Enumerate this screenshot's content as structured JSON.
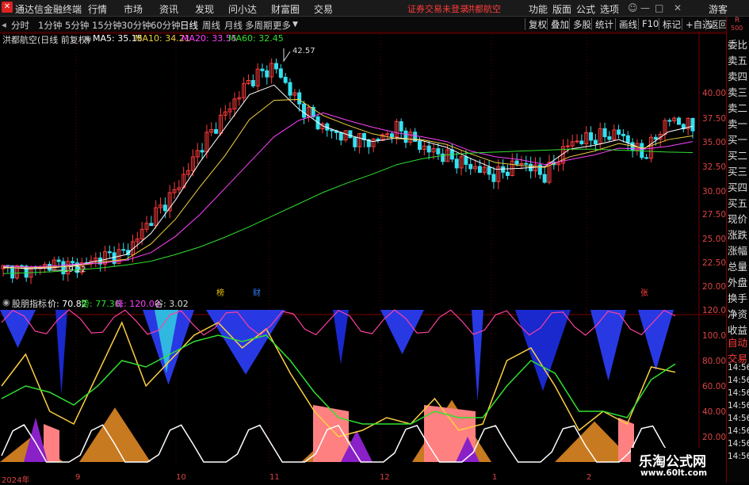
{
  "menubar": {
    "app_title": "通达信金融终端",
    "menus": [
      "行情",
      "市场",
      "资讯",
      "发现",
      "问小达",
      "财富圈",
      "交易"
    ],
    "status_text": "证券交易未登录",
    "stock_name": "洪都航空",
    "right_menus": [
      "功能",
      "版面",
      "公式",
      "选项"
    ],
    "guest": "游客"
  },
  "periodbar": {
    "periods": [
      "分时",
      "1分钟",
      "5分钟",
      "15分钟",
      "30分钟",
      "60分钟",
      "日线",
      "周线",
      "月线",
      "多周期",
      "更多"
    ],
    "active": "日线",
    "tools": [
      "复权",
      "叠加",
      "多股",
      "统计",
      "画线",
      "F10",
      "标记",
      "+自选",
      "返回"
    ]
  },
  "main_legend": {
    "title": "洪都航空(日线 前复权)",
    "ma5": "MA5: 35.15",
    "ma10": "MA10: 34.21",
    "ma20": "MA20: 33.55",
    "ma60": "MA60: 32.45"
  },
  "price_annotations": {
    "high": "42.57",
    "low": "19.22"
  },
  "price_axis": [
    "40.00",
    "37.50",
    "35.00",
    "32.50",
    "30.00",
    "27.50",
    "25.00",
    "22.50",
    "20.00"
  ],
  "event_marks": [
    "榜",
    "财",
    "张"
  ],
  "sub_legend": {
    "title": "股朋指标",
    "price": "价: 70.82",
    "trend": "势: 77.36",
    "top": "峰: 120.00",
    "bottom": "谷: 3.02"
  },
  "sub_axis": [
    "120.0",
    "100.0",
    "80.00",
    "60.00",
    "40.00",
    "20.00"
  ],
  "x_axis": [
    "2024年",
    "9",
    "10",
    "11",
    "12",
    "1",
    "2"
  ],
  "right_panel": {
    "top_label": "R",
    "top_number": "500",
    "items": [
      "委比",
      "卖五",
      "卖四",
      "卖三",
      "卖二",
      "卖一",
      "买一",
      "买二",
      "买三",
      "买四",
      "买五",
      "现价",
      "涨跌",
      "涨幅",
      "总量",
      "外盘",
      "换手",
      "净资",
      "收益",
      "自动",
      "交易",
      "14:56",
      "14:56",
      "14:56",
      "14:56",
      "14:56",
      "14:56",
      "14:56",
      "14:56"
    ]
  },
  "watermark": {
    "line1": "乐淘公式网",
    "line2": "www.60lt.com"
  },
  "colors": {
    "up": "#ff3b3b",
    "down": "#33e0f0",
    "ma5": "#ffffff",
    "ma10": "#f0d040",
    "ma20": "#ff40ff",
    "ma60": "#30e030"
  },
  "chart_data": {
    "type": "line",
    "title": "洪都航空(日线 前复权)",
    "ylim": [
      18.5,
      43.5
    ],
    "series": [
      {
        "name": "MA5",
        "values": [
          20.5,
          20.3,
          20.4,
          20.7,
          21.2,
          21.8,
          24.0,
          27.5,
          31.5,
          35.0,
          38.5,
          39.5,
          37.0,
          35.2,
          34.3,
          33.6,
          34.0,
          33.7,
          33.0,
          31.8,
          30.7,
          30.8,
          31.0,
          32.8,
          33.2,
          33.8,
          32.8,
          34.6,
          35.2
        ]
      },
      {
        "name": "MA10",
        "values": [
          20.4,
          20.4,
          20.5,
          20.6,
          21.0,
          21.3,
          22.9,
          25.5,
          28.9,
          32.1,
          35.9,
          37.9,
          38.0,
          36.3,
          35.3,
          34.4,
          33.9,
          33.8,
          33.3,
          32.3,
          31.4,
          31.1,
          30.9,
          32.0,
          32.6,
          33.4,
          32.9,
          33.8,
          34.2
        ]
      },
      {
        "name": "MA20",
        "values": [
          20.6,
          20.5,
          20.6,
          20.8,
          20.9,
          21.2,
          22.0,
          23.7,
          26.0,
          28.7,
          31.4,
          34.1,
          35.8,
          36.6,
          35.8,
          35.1,
          34.5,
          34.1,
          33.6,
          32.6,
          32.0,
          31.7,
          31.2,
          31.7,
          32.2,
          32.9,
          32.8,
          33.1,
          33.6
        ]
      },
      {
        "name": "MA60",
        "values": [
          19.8,
          19.9,
          20.0,
          20.2,
          20.4,
          20.7,
          21.1,
          21.8,
          22.6,
          23.6,
          24.7,
          25.9,
          27.1,
          28.3,
          29.3,
          30.2,
          31.2,
          31.8,
          32.2,
          32.4,
          32.5,
          32.6,
          32.7,
          32.8,
          32.8,
          32.7,
          32.6,
          32.5,
          32.45
        ]
      }
    ],
    "candles_close": [
      20.3,
      20.1,
      20.8,
      20.5,
      21.5,
      22.0,
      25.5,
      28.5,
      33.0,
      36.5,
      40.0,
      41.5,
      37.5,
      35.0,
      34.0,
      33.5,
      35.0,
      33.0,
      32.0,
      31.0,
      30.0,
      31.5,
      30.0,
      33.5,
      34.0,
      34.5,
      32.0,
      36.0,
      35.0
    ]
  },
  "sub_chart_data": {
    "type": "line",
    "title": "股朋指标",
    "ylim": [
      0,
      120
    ],
    "series": [
      {
        "name": "价",
        "values": [
          60,
          85,
          40,
          30,
          70,
          110,
          60,
          80,
          100,
          110,
          90,
          105,
          70,
          40,
          20,
          25,
          35,
          30,
          50,
          25,
          30,
          80,
          90,
          60,
          25,
          40,
          30,
          75,
          70.82
        ]
      },
      {
        "name": "势",
        "values": [
          50,
          60,
          55,
          45,
          60,
          80,
          75,
          85,
          95,
          100,
          95,
          100,
          80,
          55,
          35,
          30,
          30,
          30,
          40,
          35,
          35,
          60,
          80,
          70,
          40,
          40,
          35,
          65,
          77.36
        ]
      }
    ]
  }
}
